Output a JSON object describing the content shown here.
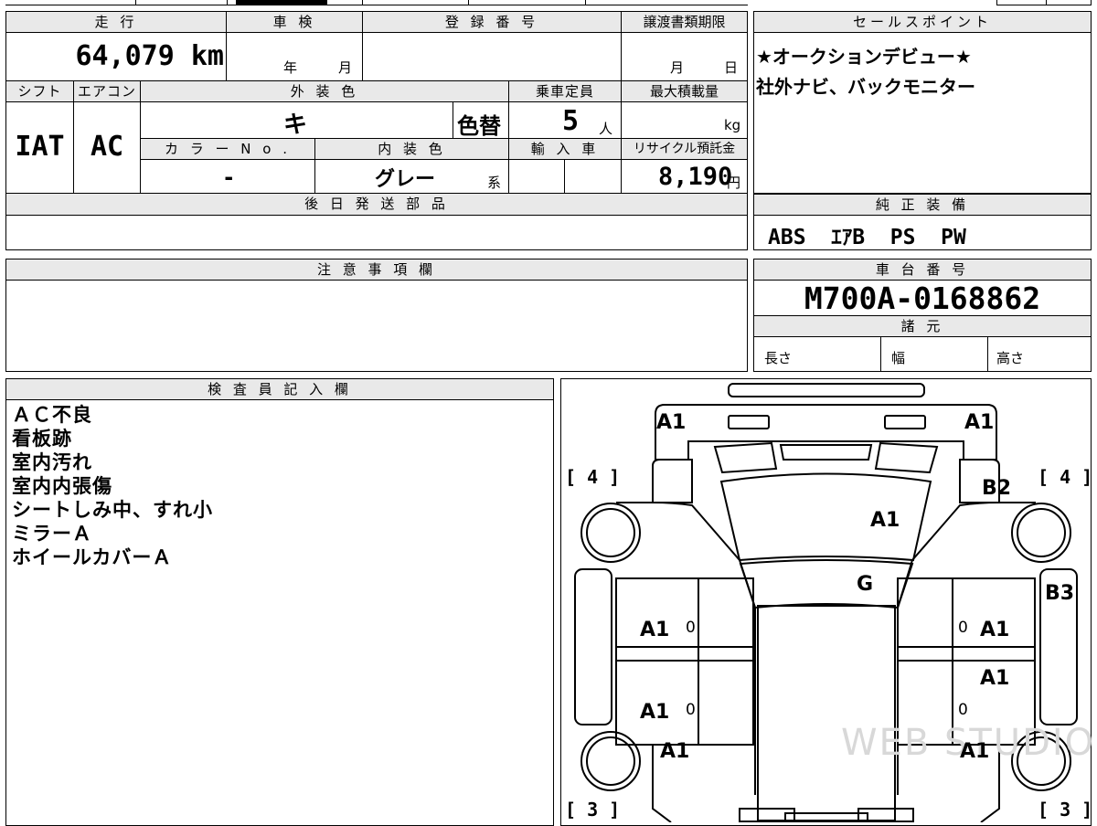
{
  "top_table": {
    "headers": {
      "mileage": "走 行",
      "inspection": "車 検",
      "registration": "登 録 番 号",
      "transfer_deadline": "譲渡書類期限",
      "shift": "シフト",
      "aircon": "エアコン",
      "exterior_color": "外 装 色",
      "capacity": "乗車定員",
      "max_load": "最大積載量",
      "color_no": "カ ラ ー N o .",
      "interior_color": "内 装 色",
      "import": "輸 入 車",
      "recycle_fee": "リサイクル預託金",
      "later_parts": "後 日 発 送 部 品"
    },
    "values": {
      "mileage": "64,079 km",
      "inspection_year": "年",
      "inspection_month": "月",
      "transfer_month": "月",
      "transfer_day": "日",
      "shift": "IAT",
      "aircon": "AC",
      "exterior_color": "キ",
      "color_change": "色替",
      "capacity": "5",
      "capacity_unit": "人",
      "max_load_unit": "kg",
      "color_no": "-",
      "interior_color": "グレー",
      "interior_suffix": "系",
      "recycle_fee": "8,190",
      "recycle_unit": "円"
    }
  },
  "sales_points": {
    "header": "セールスポイント",
    "lines": [
      "★オークションデビュー★",
      "社外ナビ、バックモニター"
    ]
  },
  "standard_equipment": {
    "header": "純 正 装 備",
    "value": "ABS  ｴｱB  PS  PW"
  },
  "notes": {
    "header": "注 意 事 項 欄"
  },
  "chassis": {
    "header": "車 台 番 号",
    "number": "M700A-0168862",
    "specs_header": "諸 元",
    "length": "長さ",
    "width": "幅",
    "height": "高さ"
  },
  "inspector": {
    "header": "検 査 員 記 入 欄",
    "items": [
      "ＡＣ不良",
      "看板跡",
      "室内汚れ",
      "室内内張傷",
      "シートしみ中、すれ小",
      "ミラーＡ",
      "ホイールカバーＡ"
    ]
  },
  "diagram": {
    "watermark": "WEB STUDIO",
    "marks": {
      "front_left": "A1",
      "front_right": "A1",
      "hood": "A1",
      "windshield": "G",
      "right_front_fender": "B2",
      "right_side": "B3",
      "left_front_door": "A1",
      "left_rear_door": "A1",
      "left_rear": "A1",
      "right_front_door": "A1",
      "right_rear_door": "A1",
      "right_rear": "A1",
      "zero1": "0",
      "zero2": "0",
      "zero3": "0",
      "zero4": "0",
      "tire_fl": "[ 4 ]",
      "tire_fr": "[ 4 ]",
      "tire_rl": "[ 3 ]",
      "tire_rr": "[ 3 ]"
    }
  }
}
